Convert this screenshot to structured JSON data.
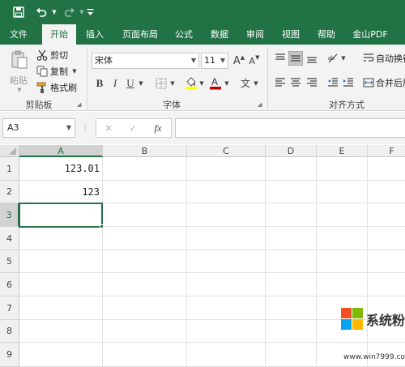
{
  "qat": {
    "save_icon": "save-icon",
    "undo_icon": "undo-icon",
    "redo_icon": "redo-icon",
    "customize_icon": "customize-icon"
  },
  "tabs": [
    {
      "label": "文件"
    },
    {
      "label": "开始"
    },
    {
      "label": "插入"
    },
    {
      "label": "页面布局"
    },
    {
      "label": "公式"
    },
    {
      "label": "数据"
    },
    {
      "label": "审阅"
    },
    {
      "label": "视图"
    },
    {
      "label": "帮助"
    },
    {
      "label": "金山PDF"
    }
  ],
  "clipboard": {
    "paste_label": "粘贴",
    "cut_label": "剪切",
    "copy_label": "复制",
    "format_painter_label": "格式刷",
    "group_label": "剪贴板"
  },
  "font": {
    "name": "宋体",
    "size": "11",
    "grow": "A",
    "shrink": "A",
    "bold": "B",
    "italic": "I",
    "underline": "U",
    "wen": "文",
    "group_label": "字体"
  },
  "alignment": {
    "wrap_label": "自动换行",
    "merge_label": "合并后居",
    "group_label": "对齐方式"
  },
  "formula_bar": {
    "name_box": "A3",
    "cancel": "✕",
    "enter": "✓",
    "fx": "fx"
  },
  "sheet": {
    "columns": [
      "A",
      "B",
      "C",
      "D",
      "E",
      "F"
    ],
    "rows": [
      "1",
      "2",
      "3",
      "4",
      "5",
      "6",
      "7",
      "8",
      "9"
    ],
    "cells": {
      "A1": "123.01",
      "A2": "123"
    },
    "active_cell": "A3"
  },
  "watermark": {
    "site_name": "系统粉",
    "url": "www.win7999.com"
  },
  "colors": {
    "accent": "#217346",
    "ribbon": "#f3f3f3",
    "font_color_bar": "#c00000",
    "fill_color_bar": "#ffff00"
  }
}
